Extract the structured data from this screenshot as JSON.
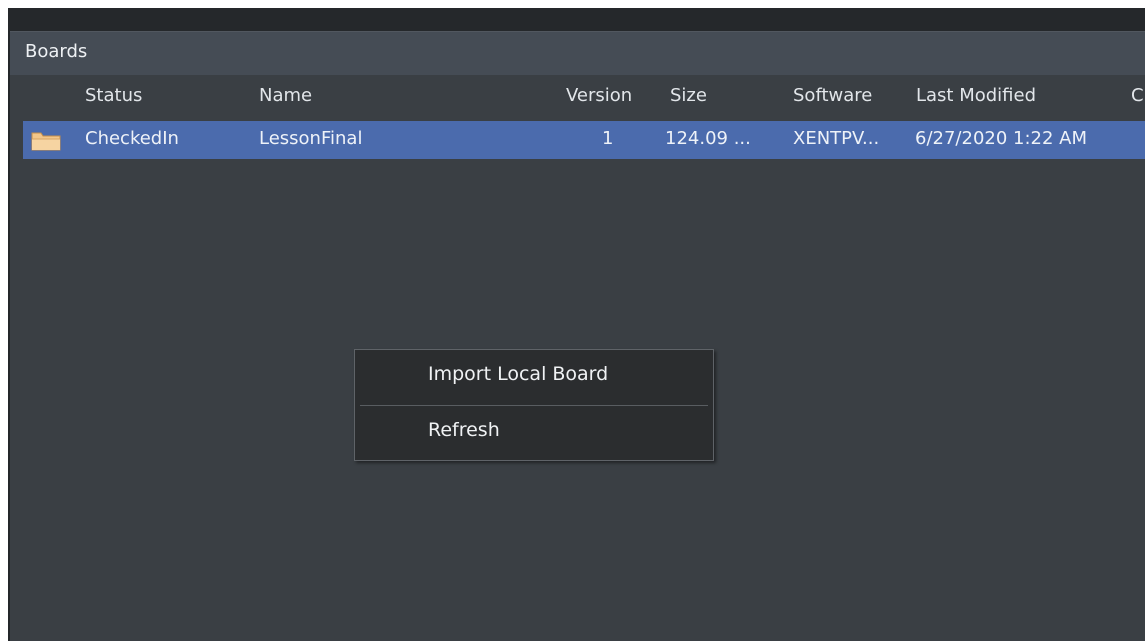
{
  "panel": {
    "title": "Boards"
  },
  "table": {
    "columns": [
      "Status",
      "Name",
      "Version",
      "Size",
      "Software",
      "Last Modified",
      "C"
    ],
    "rows": [
      {
        "icon": "folder-icon",
        "status": "CheckedIn",
        "name": "LessonFinal",
        "version": "1",
        "size": "124.09 ...",
        "software": "XENTPV...",
        "last_modified": "6/27/2020 1:22 AM"
      }
    ]
  },
  "context_menu": {
    "items": [
      "Import Local Board",
      "Refresh"
    ]
  },
  "colors": {
    "selection": "#4b6bad",
    "panel_bg": "#3a3f44",
    "header_bg": "#454c55",
    "menu_bg": "#2b2d2f",
    "folder": "#f2c68a"
  }
}
